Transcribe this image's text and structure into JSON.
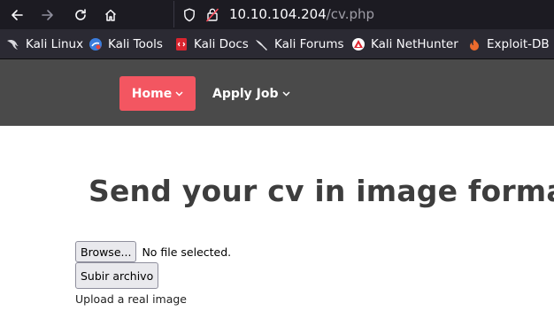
{
  "browser": {
    "url_host": "10.10.104.204",
    "url_path": "/cv.php"
  },
  "bookmarks": [
    {
      "label": "Kali Linux",
      "icon": "kali-dragon-icon"
    },
    {
      "label": "Kali Tools",
      "icon": "kali-tools-icon"
    },
    {
      "label": "Kali Docs",
      "icon": "kali-docs-icon"
    },
    {
      "label": "Kali Forums",
      "icon": "kali-forums-icon"
    },
    {
      "label": "Kali NetHunter",
      "icon": "kali-nethunter-icon"
    },
    {
      "label": "Exploit-DB",
      "icon": "exploit-db-icon"
    }
  ],
  "site_nav": {
    "home_label": "Home",
    "apply_label": "Apply Job"
  },
  "main": {
    "title": "Send your cv in image format",
    "browse_label": "Browse...",
    "no_file_text": "No file selected.",
    "submit_label": "Subir archivo",
    "hint_text": "Upload a real image"
  },
  "colors": {
    "accent": "#f35661",
    "header_bg": "#4a4a4a",
    "title": "#3d3d3d"
  }
}
